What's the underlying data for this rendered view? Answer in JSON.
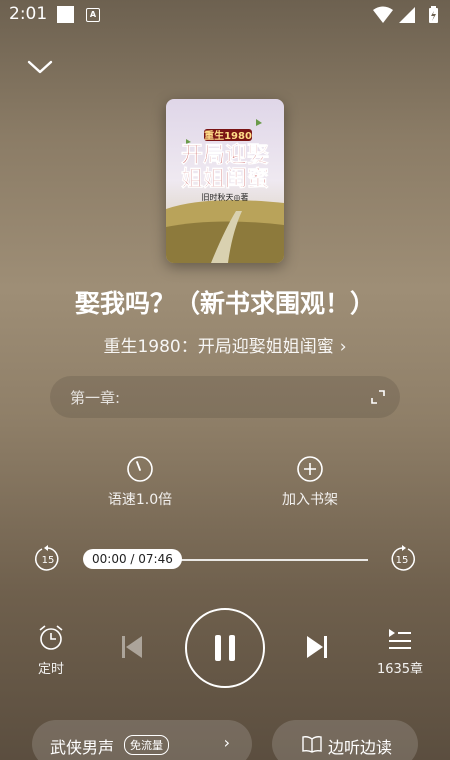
{
  "status_bar": {
    "time": "2:01",
    "notif_letter": "A"
  },
  "book": {
    "cover_series": "重生1980",
    "cover_title_line1": "开局迎娶",
    "cover_title_line2": "姐姐闺蜜",
    "cover_author": "旧时秋天◎著",
    "episode_title": "娶我吗？（新书求围观！）",
    "book_title": "重生1980：开局迎娶姐姐闺蜜",
    "book_title_arrow": "›"
  },
  "chapter": {
    "label": "第一章:"
  },
  "actions": {
    "speed_label": "语速1.0倍",
    "add_shelf_label": "加入书架"
  },
  "progress": {
    "time_text": "00:00 / 07:46",
    "back_seconds": "15",
    "forward_seconds": "15",
    "fraction": 0.0
  },
  "controls": {
    "timer_label": "定时",
    "chapters_label": "1635章"
  },
  "bottom": {
    "voice_name": "武侠男声",
    "voice_badge": "免流量",
    "voice_chevron": "›",
    "read_label": "边听边读"
  }
}
